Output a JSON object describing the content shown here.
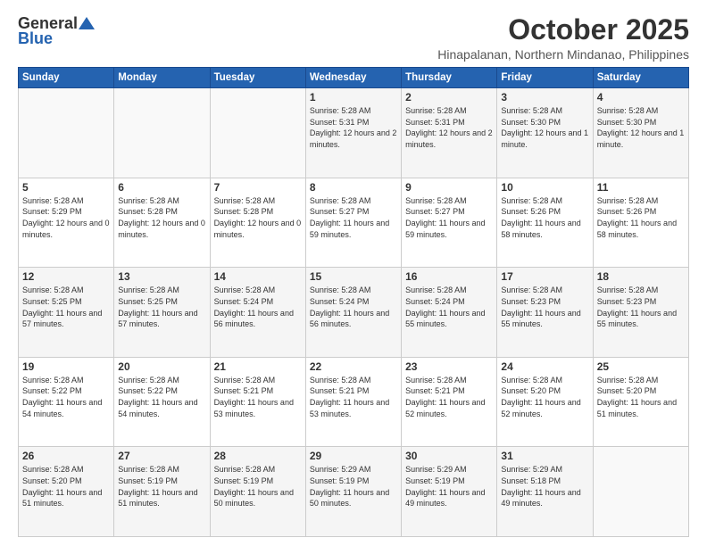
{
  "header": {
    "logo_general": "General",
    "logo_blue": "Blue",
    "month": "October 2025",
    "location": "Hinapalanan, Northern Mindanao, Philippines"
  },
  "weekdays": [
    "Sunday",
    "Monday",
    "Tuesday",
    "Wednesday",
    "Thursday",
    "Friday",
    "Saturday"
  ],
  "weeks": [
    [
      {
        "day": "",
        "sunrise": "",
        "sunset": "",
        "daylight": ""
      },
      {
        "day": "",
        "sunrise": "",
        "sunset": "",
        "daylight": ""
      },
      {
        "day": "",
        "sunrise": "",
        "sunset": "",
        "daylight": ""
      },
      {
        "day": "1",
        "sunrise": "Sunrise: 5:28 AM",
        "sunset": "Sunset: 5:31 PM",
        "daylight": "Daylight: 12 hours and 2 minutes."
      },
      {
        "day": "2",
        "sunrise": "Sunrise: 5:28 AM",
        "sunset": "Sunset: 5:31 PM",
        "daylight": "Daylight: 12 hours and 2 minutes."
      },
      {
        "day": "3",
        "sunrise": "Sunrise: 5:28 AM",
        "sunset": "Sunset: 5:30 PM",
        "daylight": "Daylight: 12 hours and 1 minute."
      },
      {
        "day": "4",
        "sunrise": "Sunrise: 5:28 AM",
        "sunset": "Sunset: 5:30 PM",
        "daylight": "Daylight: 12 hours and 1 minute."
      }
    ],
    [
      {
        "day": "5",
        "sunrise": "Sunrise: 5:28 AM",
        "sunset": "Sunset: 5:29 PM",
        "daylight": "Daylight: 12 hours and 0 minutes."
      },
      {
        "day": "6",
        "sunrise": "Sunrise: 5:28 AM",
        "sunset": "Sunset: 5:28 PM",
        "daylight": "Daylight: 12 hours and 0 minutes."
      },
      {
        "day": "7",
        "sunrise": "Sunrise: 5:28 AM",
        "sunset": "Sunset: 5:28 PM",
        "daylight": "Daylight: 12 hours and 0 minutes."
      },
      {
        "day": "8",
        "sunrise": "Sunrise: 5:28 AM",
        "sunset": "Sunset: 5:27 PM",
        "daylight": "Daylight: 11 hours and 59 minutes."
      },
      {
        "day": "9",
        "sunrise": "Sunrise: 5:28 AM",
        "sunset": "Sunset: 5:27 PM",
        "daylight": "Daylight: 11 hours and 59 minutes."
      },
      {
        "day": "10",
        "sunrise": "Sunrise: 5:28 AM",
        "sunset": "Sunset: 5:26 PM",
        "daylight": "Daylight: 11 hours and 58 minutes."
      },
      {
        "day": "11",
        "sunrise": "Sunrise: 5:28 AM",
        "sunset": "Sunset: 5:26 PM",
        "daylight": "Daylight: 11 hours and 58 minutes."
      }
    ],
    [
      {
        "day": "12",
        "sunrise": "Sunrise: 5:28 AM",
        "sunset": "Sunset: 5:25 PM",
        "daylight": "Daylight: 11 hours and 57 minutes."
      },
      {
        "day": "13",
        "sunrise": "Sunrise: 5:28 AM",
        "sunset": "Sunset: 5:25 PM",
        "daylight": "Daylight: 11 hours and 57 minutes."
      },
      {
        "day": "14",
        "sunrise": "Sunrise: 5:28 AM",
        "sunset": "Sunset: 5:24 PM",
        "daylight": "Daylight: 11 hours and 56 minutes."
      },
      {
        "day": "15",
        "sunrise": "Sunrise: 5:28 AM",
        "sunset": "Sunset: 5:24 PM",
        "daylight": "Daylight: 11 hours and 56 minutes."
      },
      {
        "day": "16",
        "sunrise": "Sunrise: 5:28 AM",
        "sunset": "Sunset: 5:24 PM",
        "daylight": "Daylight: 11 hours and 55 minutes."
      },
      {
        "day": "17",
        "sunrise": "Sunrise: 5:28 AM",
        "sunset": "Sunset: 5:23 PM",
        "daylight": "Daylight: 11 hours and 55 minutes."
      },
      {
        "day": "18",
        "sunrise": "Sunrise: 5:28 AM",
        "sunset": "Sunset: 5:23 PM",
        "daylight": "Daylight: 11 hours and 55 minutes."
      }
    ],
    [
      {
        "day": "19",
        "sunrise": "Sunrise: 5:28 AM",
        "sunset": "Sunset: 5:22 PM",
        "daylight": "Daylight: 11 hours and 54 minutes."
      },
      {
        "day": "20",
        "sunrise": "Sunrise: 5:28 AM",
        "sunset": "Sunset: 5:22 PM",
        "daylight": "Daylight: 11 hours and 54 minutes."
      },
      {
        "day": "21",
        "sunrise": "Sunrise: 5:28 AM",
        "sunset": "Sunset: 5:21 PM",
        "daylight": "Daylight: 11 hours and 53 minutes."
      },
      {
        "day": "22",
        "sunrise": "Sunrise: 5:28 AM",
        "sunset": "Sunset: 5:21 PM",
        "daylight": "Daylight: 11 hours and 53 minutes."
      },
      {
        "day": "23",
        "sunrise": "Sunrise: 5:28 AM",
        "sunset": "Sunset: 5:21 PM",
        "daylight": "Daylight: 11 hours and 52 minutes."
      },
      {
        "day": "24",
        "sunrise": "Sunrise: 5:28 AM",
        "sunset": "Sunset: 5:20 PM",
        "daylight": "Daylight: 11 hours and 52 minutes."
      },
      {
        "day": "25",
        "sunrise": "Sunrise: 5:28 AM",
        "sunset": "Sunset: 5:20 PM",
        "daylight": "Daylight: 11 hours and 51 minutes."
      }
    ],
    [
      {
        "day": "26",
        "sunrise": "Sunrise: 5:28 AM",
        "sunset": "Sunset: 5:20 PM",
        "daylight": "Daylight: 11 hours and 51 minutes."
      },
      {
        "day": "27",
        "sunrise": "Sunrise: 5:28 AM",
        "sunset": "Sunset: 5:19 PM",
        "daylight": "Daylight: 11 hours and 51 minutes."
      },
      {
        "day": "28",
        "sunrise": "Sunrise: 5:28 AM",
        "sunset": "Sunset: 5:19 PM",
        "daylight": "Daylight: 11 hours and 50 minutes."
      },
      {
        "day": "29",
        "sunrise": "Sunrise: 5:29 AM",
        "sunset": "Sunset: 5:19 PM",
        "daylight": "Daylight: 11 hours and 50 minutes."
      },
      {
        "day": "30",
        "sunrise": "Sunrise: 5:29 AM",
        "sunset": "Sunset: 5:19 PM",
        "daylight": "Daylight: 11 hours and 49 minutes."
      },
      {
        "day": "31",
        "sunrise": "Sunrise: 5:29 AM",
        "sunset": "Sunset: 5:18 PM",
        "daylight": "Daylight: 11 hours and 49 minutes."
      },
      {
        "day": "",
        "sunrise": "",
        "sunset": "",
        "daylight": ""
      }
    ]
  ]
}
